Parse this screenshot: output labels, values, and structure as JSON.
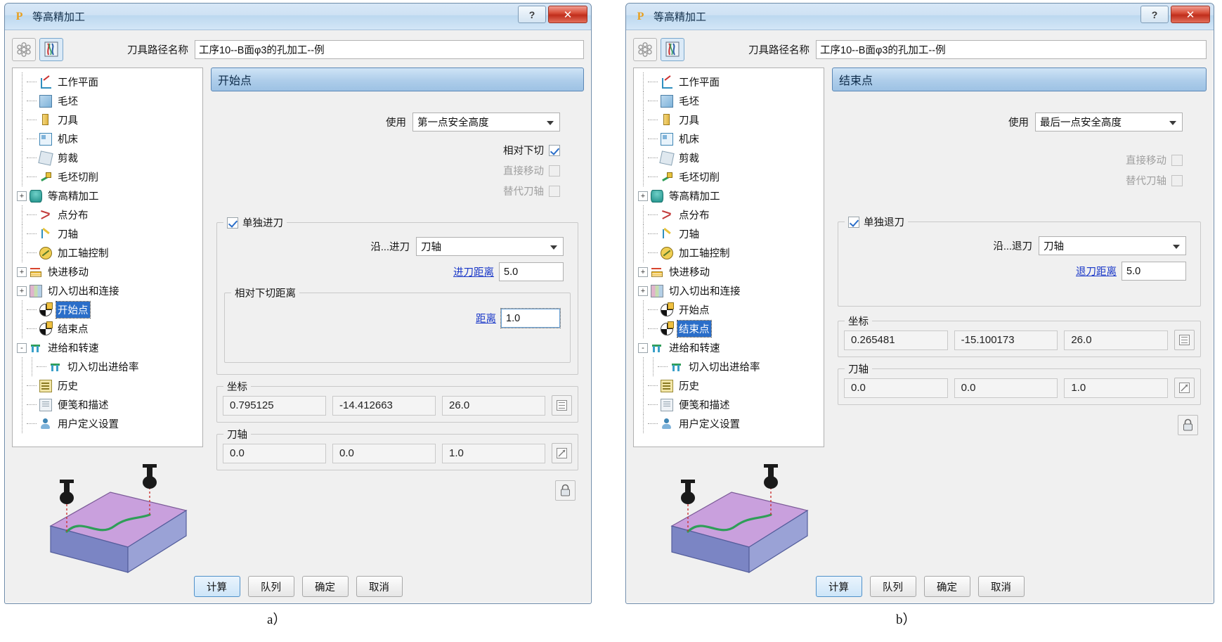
{
  "panels": [
    {
      "key": "a",
      "caption": "a）",
      "title": "等高精加工",
      "titlebar": {
        "logo": "P",
        "help_label": "?",
        "close_label": "✕"
      },
      "toolbar": {
        "icon_left": "gear-icon",
        "icon_right": "toolpath-icon",
        "path_label": "刀具路径名称",
        "path_value": "工序10--B面φ3的孔加工--例"
      },
      "tree": {
        "items": [
          {
            "label": "工作平面",
            "icon": "workplane-icon",
            "indent": 1,
            "expander": ""
          },
          {
            "label": "毛坯",
            "icon": "block-icon",
            "indent": 1,
            "expander": ""
          },
          {
            "label": "刀具",
            "icon": "tool-icon",
            "indent": 1,
            "expander": ""
          },
          {
            "label": "机床",
            "icon": "machine-icon",
            "indent": 1,
            "expander": ""
          },
          {
            "label": "剪裁",
            "icon": "trim-icon",
            "indent": 1,
            "expander": ""
          },
          {
            "label": "毛坯切削",
            "icon": "stock-cut-icon",
            "indent": 1,
            "expander": ""
          },
          {
            "label": "等高精加工",
            "icon": "cylinder-icon",
            "indent": 0,
            "expander": "+"
          },
          {
            "label": "点分布",
            "icon": "points-icon",
            "indent": 1,
            "expander": ""
          },
          {
            "label": "刀轴",
            "icon": "tool-axis-icon",
            "indent": 1,
            "expander": ""
          },
          {
            "label": "加工轴控制",
            "icon": "axis-ctrl-icon",
            "indent": 1,
            "expander": ""
          },
          {
            "label": "快进移动",
            "icon": "rapid-move-icon",
            "indent": 0,
            "expander": "+"
          },
          {
            "label": "切入切出和连接",
            "icon": "leads-links-icon",
            "indent": 0,
            "expander": "+"
          },
          {
            "label": "开始点",
            "icon": "start-point-icon",
            "indent": 1,
            "expander": "",
            "selected": true
          },
          {
            "label": "结束点",
            "icon": "end-point-icon",
            "indent": 1,
            "expander": ""
          },
          {
            "label": "进给和转速",
            "icon": "feed-speed-icon",
            "indent": 0,
            "expander": "-"
          },
          {
            "label": "切入切出进给率",
            "icon": "feed-rate-icon",
            "indent": 2,
            "expander": ""
          },
          {
            "label": "历史",
            "icon": "history-icon",
            "indent": 1,
            "expander": ""
          },
          {
            "label": "便笺和描述",
            "icon": "notes-icon",
            "indent": 1,
            "expander": ""
          },
          {
            "label": "用户定义设置",
            "icon": "user-settings-icon",
            "indent": 1,
            "expander": ""
          }
        ]
      },
      "pane": {
        "header": "开始点",
        "use_label": "使用",
        "use_value": "第一点安全高度",
        "checkboxes": [
          {
            "label": "相对下切",
            "checked": true,
            "enabled": true
          },
          {
            "label": "直接移动",
            "checked": false,
            "enabled": false
          },
          {
            "label": "替代刀轴",
            "checked": false,
            "enabled": false
          }
        ],
        "move_group": {
          "title": "单独进刀",
          "checked": true,
          "along_label": "沿...进刀",
          "along_value": "刀轴",
          "distance_label": "进刀距离",
          "distance_value": "5.0",
          "sub_group": {
            "title": "相对下切距离",
            "distance_label": "距离",
            "distance_value": "1.0",
            "focused": true
          }
        },
        "coords": {
          "title": "坐标",
          "values": [
            "0.795125",
            "-14.412663",
            "26.0"
          ],
          "picker_icon": "coord-picker-icon"
        },
        "axis": {
          "title": "刀轴",
          "values": [
            "0.0",
            "0.0",
            "1.0"
          ],
          "picker_icon": "axis-picker-icon"
        },
        "lock_icon": "lock-icon"
      },
      "footer": {
        "buttons": [
          {
            "label": "计算",
            "default": true
          },
          {
            "label": "队列",
            "default": false
          },
          {
            "label": "确定",
            "default": false
          },
          {
            "label": "取消",
            "default": false
          }
        ]
      }
    },
    {
      "key": "b",
      "caption": "b）",
      "title": "等高精加工",
      "titlebar": {
        "logo": "P",
        "help_label": "?",
        "close_label": "✕"
      },
      "toolbar": {
        "icon_left": "gear-icon",
        "icon_right": "toolpath-icon",
        "path_label": "刀具路径名称",
        "path_value": "工序10--B面φ3的孔加工--例"
      },
      "tree": {
        "items": [
          {
            "label": "工作平面",
            "icon": "workplane-icon",
            "indent": 1,
            "expander": ""
          },
          {
            "label": "毛坯",
            "icon": "block-icon",
            "indent": 1,
            "expander": ""
          },
          {
            "label": "刀具",
            "icon": "tool-icon",
            "indent": 1,
            "expander": ""
          },
          {
            "label": "机床",
            "icon": "machine-icon",
            "indent": 1,
            "expander": ""
          },
          {
            "label": "剪裁",
            "icon": "trim-icon",
            "indent": 1,
            "expander": ""
          },
          {
            "label": "毛坯切削",
            "icon": "stock-cut-icon",
            "indent": 1,
            "expander": ""
          },
          {
            "label": "等高精加工",
            "icon": "cylinder-icon",
            "indent": 0,
            "expander": "+"
          },
          {
            "label": "点分布",
            "icon": "points-icon",
            "indent": 1,
            "expander": ""
          },
          {
            "label": "刀轴",
            "icon": "tool-axis-icon",
            "indent": 1,
            "expander": ""
          },
          {
            "label": "加工轴控制",
            "icon": "axis-ctrl-icon",
            "indent": 1,
            "expander": ""
          },
          {
            "label": "快进移动",
            "icon": "rapid-move-icon",
            "indent": 0,
            "expander": "+"
          },
          {
            "label": "切入切出和连接",
            "icon": "leads-links-icon",
            "indent": 0,
            "expander": "+"
          },
          {
            "label": "开始点",
            "icon": "start-point-icon",
            "indent": 1,
            "expander": ""
          },
          {
            "label": "结束点",
            "icon": "end-point-icon",
            "indent": 1,
            "expander": "",
            "selected": true
          },
          {
            "label": "进给和转速",
            "icon": "feed-speed-icon",
            "indent": 0,
            "expander": "-"
          },
          {
            "label": "切入切出进给率",
            "icon": "feed-rate-icon",
            "indent": 2,
            "expander": ""
          },
          {
            "label": "历史",
            "icon": "history-icon",
            "indent": 1,
            "expander": ""
          },
          {
            "label": "便笺和描述",
            "icon": "notes-icon",
            "indent": 1,
            "expander": ""
          },
          {
            "label": "用户定义设置",
            "icon": "user-settings-icon",
            "indent": 1,
            "expander": ""
          }
        ]
      },
      "pane": {
        "header": "结束点",
        "use_label": "使用",
        "use_value": "最后一点安全高度",
        "checkboxes": [
          {
            "label": "直接移动",
            "checked": false,
            "enabled": false
          },
          {
            "label": "替代刀轴",
            "checked": false,
            "enabled": false
          }
        ],
        "move_group": {
          "title": "单独退刀",
          "checked": true,
          "along_label": "沿...退刀",
          "along_value": "刀轴",
          "distance_label": "退刀距离",
          "distance_value": "5.0",
          "sub_group": null
        },
        "coords": {
          "title": "坐标",
          "values": [
            "0.265481",
            "-15.100173",
            "26.0"
          ],
          "picker_icon": "coord-picker-icon"
        },
        "axis": {
          "title": "刀轴",
          "values": [
            "0.0",
            "0.0",
            "1.0"
          ],
          "picker_icon": "axis-picker-icon"
        },
        "lock_icon": "lock-icon"
      },
      "footer": {
        "buttons": [
          {
            "label": "计算",
            "default": true
          },
          {
            "label": "队列",
            "default": false
          },
          {
            "label": "确定",
            "default": false
          },
          {
            "label": "取消",
            "default": false
          }
        ]
      }
    }
  ],
  "colors": {
    "title_gradient_top": "#d7e7f6",
    "pane_header": "#aecdea",
    "selection_blue": "#2a6ec9",
    "link_blue": "#1a38c8",
    "close_red": "#c02e1c",
    "model_top": "#c9a0dd",
    "model_side": "#7b85c4",
    "toolpath_green": "#2f9e58"
  }
}
